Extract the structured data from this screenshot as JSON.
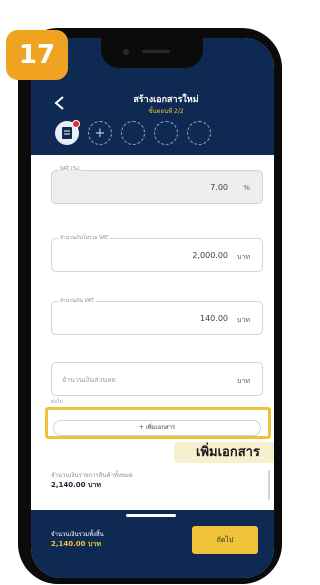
{
  "step_badge": "17",
  "header": {
    "title": "สร้างเอกสารใหม่",
    "subtitle": "ขั้นตอนที่ 2/2",
    "steps": [
      "document-icon",
      "+",
      "",
      "",
      ""
    ]
  },
  "form": {
    "vat": {
      "label": "VAT (%)",
      "value": "7.00",
      "unit": "%"
    },
    "amount_before_vat": {
      "label": "จำนวนเงินไม่รวม VAT",
      "value": "2,000.00",
      "unit": "บาท"
    },
    "vat_amount": {
      "label": "จำนวนเงิน VAT",
      "value": "140.00",
      "unit": "บาท"
    },
    "discount": {
      "placeholder": "จำนวนเงินส่วนลด",
      "unit": "บาท"
    },
    "note": "ต่อไป"
  },
  "add_document_button": "+ เพิ่มเอกสาร",
  "callout": "เพิ่มเอกสาร",
  "total_products": {
    "label": "จำนวนเงินรายการสินค้าทั้งหมด",
    "value": "2,140.00 บาท"
  },
  "footer": {
    "sum_label": "จำนวนเงินรวมทั้งสิ้น",
    "sum_value": "2,140.00 บาท",
    "next_button": "ถัดไป"
  },
  "colors": {
    "navy": "#0f2a52",
    "accent": "#f0c23a",
    "badge": "#f0a321"
  }
}
